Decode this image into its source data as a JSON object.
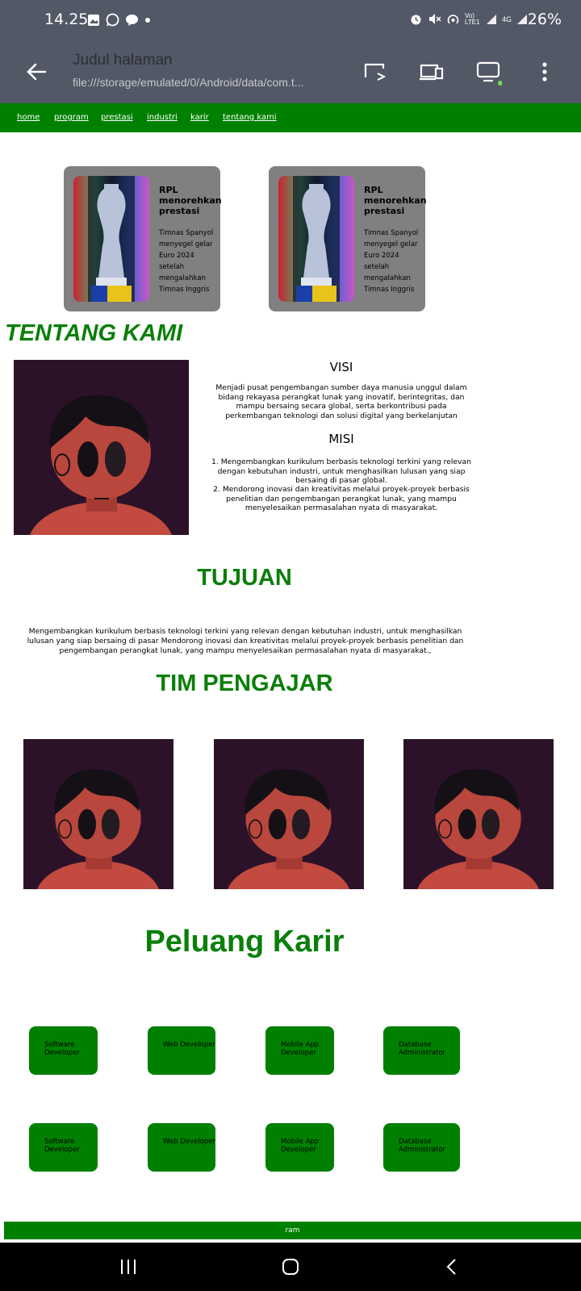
{
  "status_bar": {
    "time": "14.25",
    "battery": "26%",
    "left_icons": [
      "image-icon",
      "whatsapp-icon",
      "chat-icon",
      "dot-icon"
    ],
    "right_icons": [
      "alarm-icon",
      "mute-icon",
      "hotspot-icon",
      "volte-icon",
      "signal-icon",
      "4g-icon",
      "signal-icon",
      "battery-icon"
    ],
    "volte_label": "Vo) LTE1",
    "network_label": "4G"
  },
  "browser": {
    "title": "Judul halaman",
    "url": "file:///storage/emulated/0/Android/data/com.t...",
    "icons": [
      "back-arrow-icon",
      "cast-icon",
      "devices-icon",
      "desktop-mode-icon",
      "more-vert-icon"
    ]
  },
  "nav": {
    "links": [
      "home",
      "program",
      "prestasi",
      "industri",
      "karir",
      "tentang kami"
    ]
  },
  "cards": [
    {
      "title": "RPL menorehkan prestasi",
      "text": "Timnas Spanyol menyegel gelar Euro 2024 setelah mengalahkan Timnas Inggris"
    },
    {
      "title": "RPL menorehkan prestasi",
      "text": "Timnas Spanyol menyegel gelar Euro 2024 setelah mengalahkan Timnas Inggris"
    }
  ],
  "tentang": {
    "heading": "TENTANG KAMI",
    "visi_heading": "VISI",
    "visi_text": "Menjadi pusat pengembangan sumber daya manusia unggul dalam bidang rekayasa perangkat lunak yang inovatif, berintegritas, dan mampu bersaing secara global, serta berkontribusi pada perkembangan teknologi dan solusi digital yang berkelanjutan",
    "misi_heading": "MISI",
    "misi_items": [
      "1. Mengembangkan kurikulum berbasis teknologi terkini yang relevan dengan kebutuhan industri, untuk menghasilkan lulusan yang siap bersaing di pasar global.",
      "2. Mendorong inovasi dan kreativitas melalui proyek-proyek berbasis penelitian dan pengembangan perangkat lunak, yang mampu menyelesaikan permasalahan nyata di masyarakat."
    ]
  },
  "tujuan": {
    "heading": "TUJUAN",
    "text": "Mengembangkan kurikulum berbasis teknologi terkini yang relevan dengan kebutuhan industri, untuk menghasilkan lulusan yang siap bersaing di pasar Mendorong inovasi dan kreativitas melalui proyek-proyek berbasis penelitian dan pengembangan perangkat lunak, yang mampu menyelesaikan permasalahan nyata di masyarakat.,"
  },
  "tim": {
    "heading": "TIM PENGAJAR"
  },
  "karir": {
    "heading": "Peluang Karir",
    "row1": [
      "Software Developer",
      "Web Developer",
      "Mobile App Developer",
      "Database Administrator"
    ],
    "row2": [
      "Software Developer",
      "Web Developer",
      "Mobile App Developer",
      "Database Administrator"
    ]
  },
  "footer": {
    "text": "ram"
  },
  "system_nav": {
    "icons": [
      "recent-apps-icon",
      "home-icon",
      "back-icon"
    ]
  },
  "colors": {
    "brand_green": "#008000",
    "heading_green": "#0a7f0a",
    "toolbar": "#525866",
    "card_grey": "#808080"
  }
}
